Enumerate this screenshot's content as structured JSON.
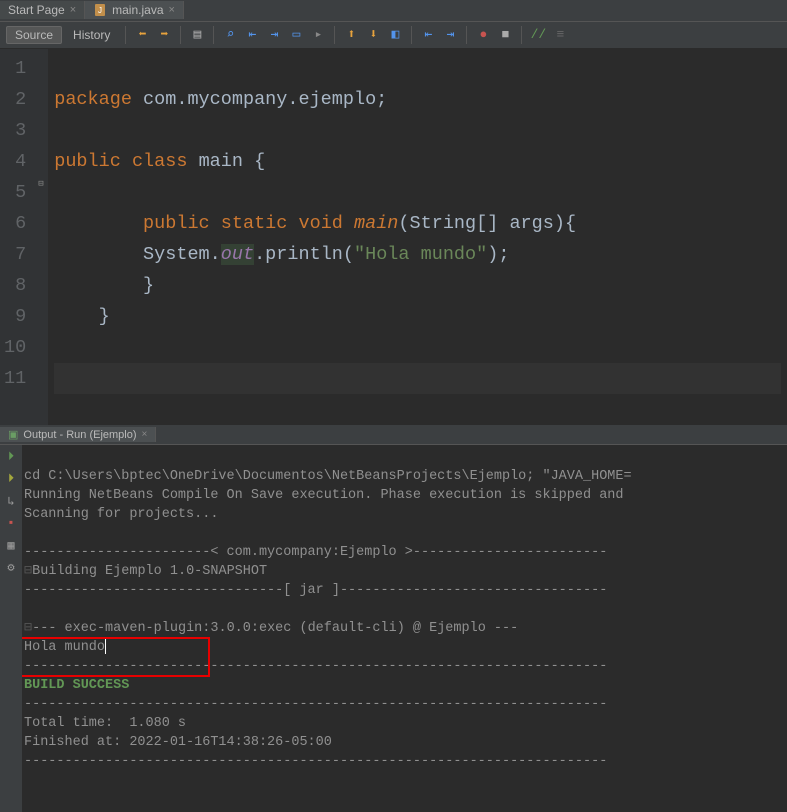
{
  "tabs": [
    {
      "label": "Start Page",
      "active": false,
      "hasIcon": false
    },
    {
      "label": "main.java",
      "active": true,
      "hasIcon": true
    }
  ],
  "toolbar": {
    "source": "Source",
    "history": "History"
  },
  "code": {
    "line1": "",
    "line2_pkg": "package ",
    "line2_name": "com.mycompany.ejemplo;",
    "line3": "",
    "line4_a": "public ",
    "line4_b": "class ",
    "line4_c": "main ",
    "line4_d": "{",
    "line5": "",
    "line6_a": "public ",
    "line6_b": "static ",
    "line6_c": "void ",
    "line6_d": "main",
    "line6_e": "(String[] args){",
    "line7_a": "System.",
    "line7_b": "out",
    "line7_c": ".println(",
    "line7_d": "\"Hola mundo\"",
    "line7_e": ");",
    "line8": "}",
    "line9": "}",
    "line10": "",
    "line11": "",
    "line_numbers": [
      "1",
      "2",
      "3",
      "4",
      "5",
      "6",
      "7",
      "8",
      "9",
      "10",
      "11"
    ]
  },
  "output": {
    "tab_label": "Output - Run (Ejemplo)",
    "lines": [
      "cd C:\\Users\\bptec\\OneDrive\\Documentos\\NetBeansProjects\\Ejemplo; \"JAVA_HOME=",
      "Running NetBeans Compile On Save execution. Phase execution is skipped and ",
      "Scanning for projects...",
      "",
      "-----------------------< com.mycompany:Ejemplo >------------------------",
      "Building Ejemplo 1.0-SNAPSHOT",
      "--------------------------------[ jar ]---------------------------------",
      "",
      "--- exec-maven-plugin:3.0.0:exec (default-cli) @ Ejemplo ---",
      "Hola mundo",
      "------------------------------------------------------------------------",
      "BUILD SUCCESS",
      "------------------------------------------------------------------------",
      "Total time:  1.080 s",
      "Finished at: 2022-01-16T14:38:26-05:00",
      "------------------------------------------------------------------------"
    ]
  }
}
